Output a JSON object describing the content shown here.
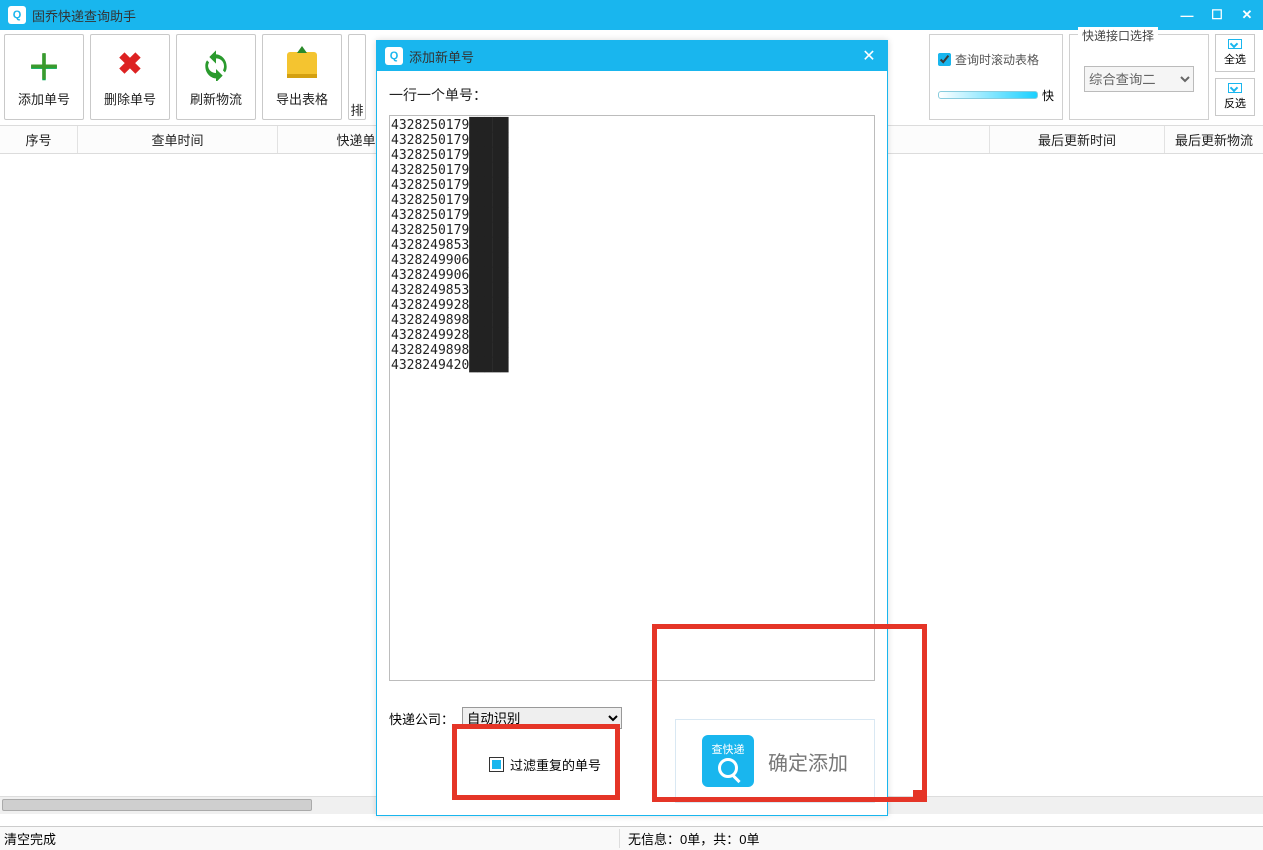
{
  "window": {
    "title": "固乔快递查询助手"
  },
  "toolbar": {
    "add": "添加单号",
    "delete": "删除单号",
    "refresh": "刷新物流",
    "export": "导出表格",
    "truncated": "排"
  },
  "options": {
    "scroll_on_query": "查询时滚动表格",
    "speed_suffix": "快",
    "interface_legend": "快递接口选择",
    "interface_value": "综合查询二",
    "select_all": "全选",
    "invert": "反选"
  },
  "table": {
    "cols": {
      "seq": "序号",
      "query_time": "查单时间",
      "tracking_no": "快递单号",
      "last_update": "最后更新时间",
      "last_logistics": "最后更新物流"
    }
  },
  "status": {
    "left": "清空完成",
    "mid": "无信息：0单，共：0单"
  },
  "dialog": {
    "title": "添加新单号",
    "hint": "一行一个单号：",
    "textarea": "4328250179█████\n4328250179█████\n4328250179█████\n4328250179█████\n4328250179█████\n4328250179█████\n4328250179█████\n4328250179█████\n4328249853█████\n4328249906█████\n4328249906█████\n4328249853█████\n4328249928█████\n4328249898█████\n4328249928█████\n4328249898█████\n4328249420█████",
    "company_label": "快递公司：",
    "company_value": "自动识别",
    "filter_dup": "过滤重复的单号",
    "confirm_icon_text": "查快递",
    "confirm": "确定添加"
  }
}
